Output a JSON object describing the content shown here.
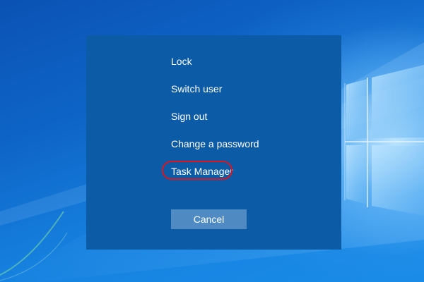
{
  "screen": {
    "background_color": "#1277d6",
    "dialog_color": "#0b5ba6",
    "highlight_color": "#e0141e",
    "cancel_button_color": "#4f8ac3"
  },
  "security_options": {
    "items": [
      {
        "label": "Lock"
      },
      {
        "label": "Switch user"
      },
      {
        "label": "Sign out"
      },
      {
        "label": "Change a password"
      },
      {
        "label": "Task Manager",
        "highlighted": true
      }
    ],
    "cancel_label": "Cancel"
  },
  "wallpaper": {
    "icon": "windows-10-logo-light"
  }
}
